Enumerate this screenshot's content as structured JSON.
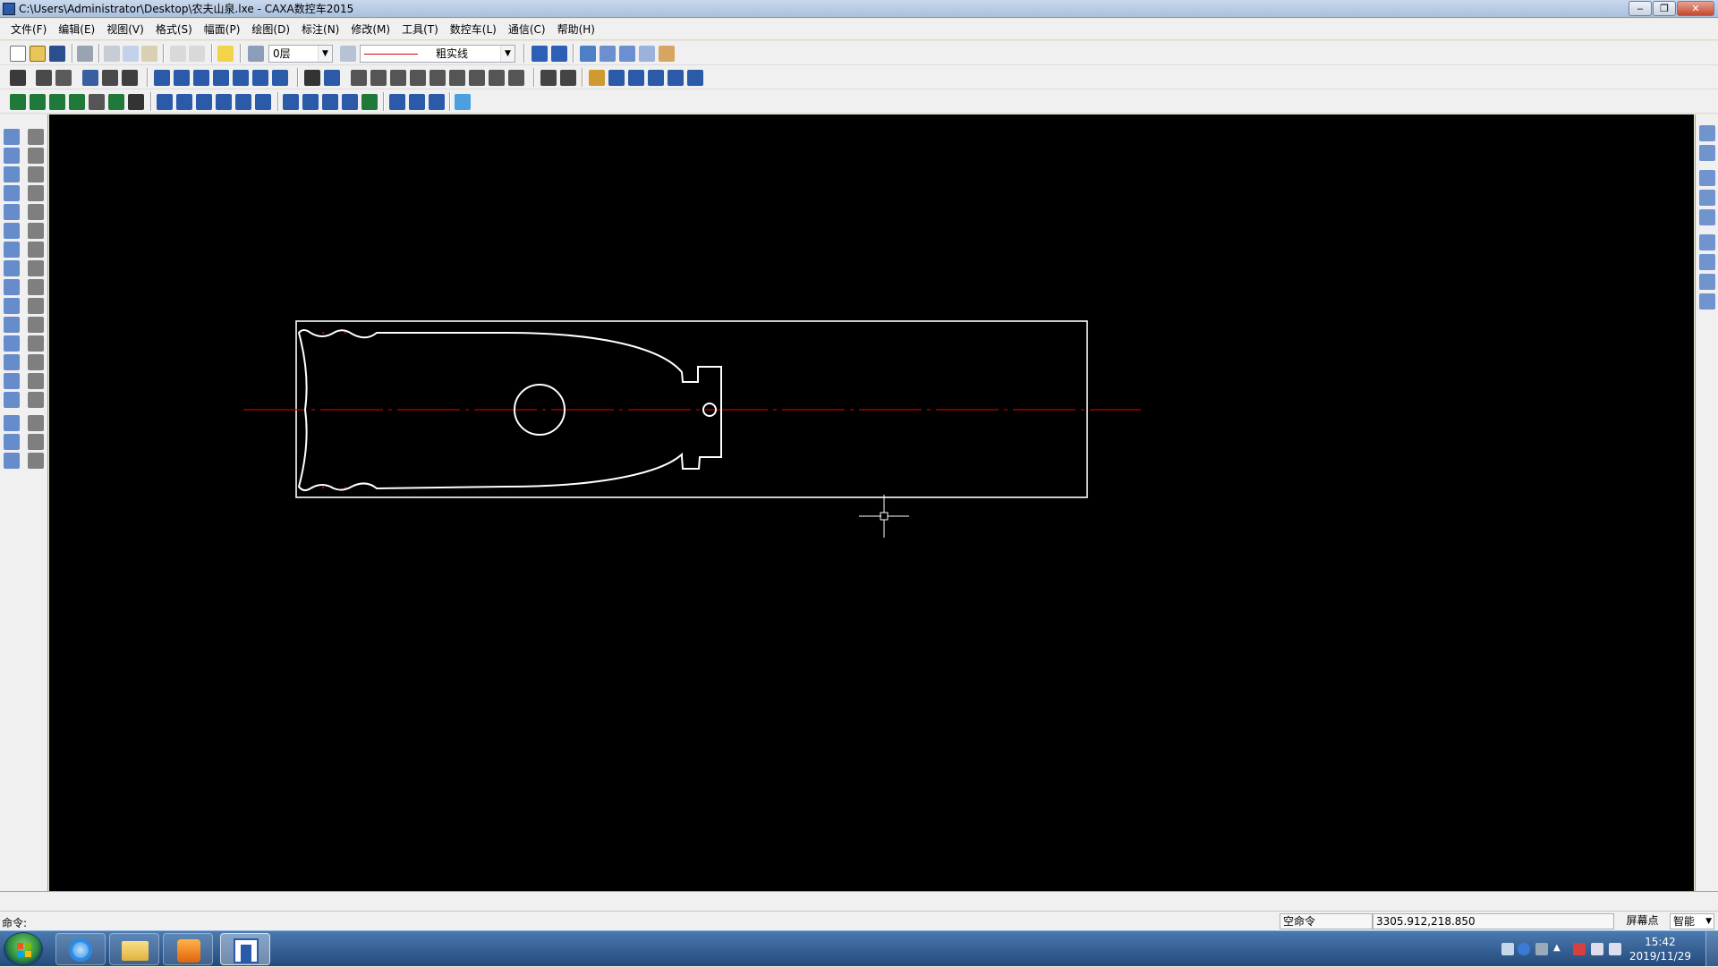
{
  "window": {
    "title": "C:\\Users\\Administrator\\Desktop\\农夫山泉.lxe - CAXA数控车2015",
    "buttons": {
      "minimize": "‒",
      "maximize": "❐",
      "close": "✕"
    }
  },
  "menu": [
    "文件(F)",
    "编辑(E)",
    "视图(V)",
    "格式(S)",
    "幅面(P)",
    "绘图(D)",
    "标注(N)",
    "修改(M)",
    "工具(T)",
    "数控车(L)",
    "通信(C)",
    "帮助(H)"
  ],
  "toolbar": {
    "layer_value": "0层",
    "linetype_value": "粗实线",
    "linecolor": "#e00000"
  },
  "status": {
    "command_label": "命令:",
    "command_state": "空命令",
    "coordinates": "3305.912,218.850",
    "snap_label": "屏幕点",
    "snap_mode": "智能"
  },
  "taskbar": {
    "time": "15:42",
    "date": "2019/11/29"
  },
  "colors": {
    "canvas_bg": "#000000",
    "drawing_stroke": "#ffffff",
    "centerline": "#c00000"
  },
  "icons": {
    "start": "windows-start-icon",
    "ie": "internet-explorer-icon",
    "explorer": "folder-icon",
    "media": "media-player-icon",
    "caxa": "caxa-app-icon"
  }
}
